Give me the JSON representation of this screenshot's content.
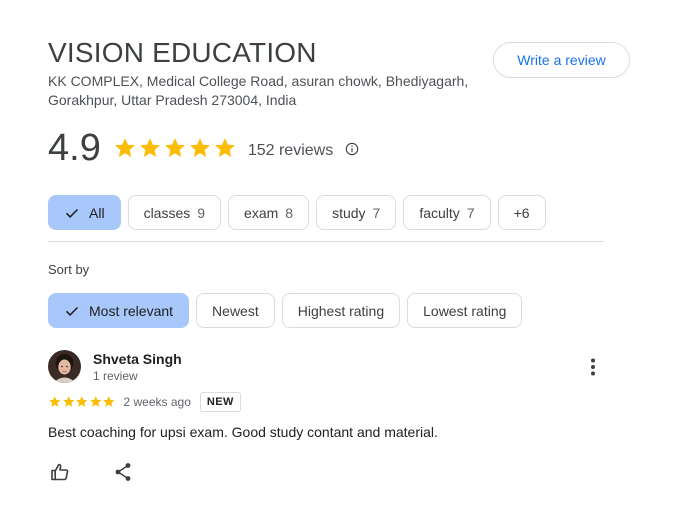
{
  "place": {
    "title": "VISION EDUCATION",
    "address": "KK COMPLEX, Medical College Road, asuran chowk, Bhediyagarh, Gorakhpur, Uttar Pradesh 273004, India"
  },
  "actions": {
    "write_review_label": "Write a review"
  },
  "summary": {
    "rating": "4.9",
    "stars": 5,
    "review_count": "152 reviews",
    "star_color": "#fbbc04"
  },
  "topic_chips": [
    {
      "label": "All",
      "count": "",
      "selected": true
    },
    {
      "label": "classes",
      "count": "9",
      "selected": false
    },
    {
      "label": "exam",
      "count": "8",
      "selected": false
    },
    {
      "label": "study",
      "count": "7",
      "selected": false
    },
    {
      "label": "faculty",
      "count": "7",
      "selected": false
    },
    {
      "label": "+6",
      "count": "",
      "selected": false
    }
  ],
  "sort": {
    "label": "Sort by",
    "options": [
      {
        "label": "Most relevant",
        "selected": true
      },
      {
        "label": "Newest",
        "selected": false
      },
      {
        "label": "Highest rating",
        "selected": false
      },
      {
        "label": "Lowest rating",
        "selected": false
      }
    ]
  },
  "review": {
    "name": "Shveta Singh",
    "meta": "1 review",
    "rating": 5,
    "time": "2 weeks ago",
    "badge": "NEW",
    "text": "Best coaching for upsi exam. Good study contant and material."
  },
  "colors": {
    "accent": "#1a73e8",
    "selected_chip": "#a8c7fa"
  }
}
